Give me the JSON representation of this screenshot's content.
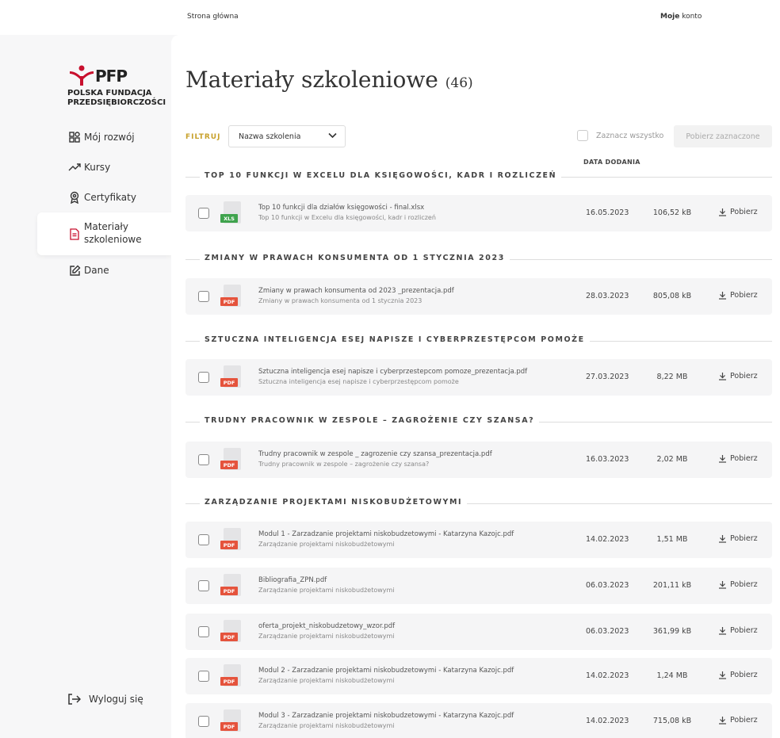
{
  "topbar": {
    "home_link": "Strona główna",
    "account_bold": "Moje",
    "account_rest": " konto"
  },
  "logo": {
    "brand": "PFP",
    "line1": "POLSKA FUNDACJA",
    "line2": "PRZEDSIĘBIORCZOŚCI",
    "brand_color": "#c8102e"
  },
  "sidebar": {
    "items": [
      {
        "label": "Mój rozwój",
        "icon": "grid-icon"
      },
      {
        "label": "Kursy",
        "icon": "trend-icon"
      },
      {
        "label": "Certyfikaty",
        "icon": "award-icon"
      },
      {
        "label": "Materiały szkoleniowe",
        "icon": "document-icon",
        "active": true
      },
      {
        "label": "Dane",
        "icon": "edit-icon"
      }
    ],
    "logout": "Wyloguj się"
  },
  "main": {
    "title": "Materiały szkoleniowe",
    "count": "(46)",
    "filter_label": "FILTRUJ",
    "filter_value": "Nazwa szkolenia",
    "select_all": "Zaznacz wszystko",
    "download_selected": "Pobierz zaznaczone",
    "date_header": "DATA DODANIA",
    "download_label": "Pobierz"
  },
  "sections": [
    {
      "title": "TOP 10 FUNKCJI W EXCELU DLA KSIĘGOWOŚCI, KADR I ROZLICZEŃ",
      "files": [
        {
          "type": "XLS",
          "name": "Top 10 funkcji dla działów księgowości - final.xlsx",
          "desc": "Top 10 funkcji w Excelu dla księgowości, kadr i rozliczeń",
          "date": "16.05.2023",
          "size": "106,52 kB"
        }
      ]
    },
    {
      "title": "ZMIANY W PRAWACH KONSUMENTA OD 1 STYCZNIA 2023",
      "files": [
        {
          "type": "PDF",
          "name": "Zmiany w prawach konsumenta od 2023 _prezentacja.pdf",
          "desc": "Zmiany w prawach konsumenta od 1 stycznia 2023",
          "date": "28.03.2023",
          "size": "805,08 kB"
        }
      ]
    },
    {
      "title": "SZTUCZNA INTELIGENCJA ESEJ NAPISZE I CYBERPRZESTĘPCOM POMOŻE",
      "files": [
        {
          "type": "PDF",
          "name": "Sztuczna inteligencja esej napisze i cyberprzestepcom pomoze_prezentacja.pdf",
          "desc": "Sztuczna inteligencja esej napisze i cyberprzestępcom pomoże",
          "date": "27.03.2023",
          "size": "8,22 MB"
        }
      ]
    },
    {
      "title": "TRUDNY PRACOWNIK W ZESPOLE – ZAGROŻENIE CZY SZANSA?",
      "files": [
        {
          "type": "PDF",
          "name": "Trudny pracownik w zespole _ zagrozenie czy szansa_prezentacja.pdf",
          "desc": "Trudny pracownik w zespole – zagrożenie czy szansa?",
          "date": "16.03.2023",
          "size": "2,02 MB"
        }
      ]
    },
    {
      "title": "ZARZĄDZANIE PROJEKTAMI NISKOBUDŻETOWYMI",
      "files": [
        {
          "type": "PDF",
          "name": "Modul 1 - Zarzadzanie projektami niskobudzetowymi - Katarzyna Kazojc.pdf",
          "desc": "Zarządzanie projektami niskobudżetowymi",
          "date": "14.02.2023",
          "size": "1,51 MB"
        },
        {
          "type": "PDF",
          "name": "Bibliografia_ZPN.pdf",
          "desc": "Zarządzanie projektami niskobudżetowymi",
          "date": "06.03.2023",
          "size": "201,11 kB"
        },
        {
          "type": "PDF",
          "name": "oferta_projekt_niskobudzetowy_wzor.pdf",
          "desc": "Zarządzanie projektami niskobudżetowymi",
          "date": "06.03.2023",
          "size": "361,99 kB"
        },
        {
          "type": "PDF",
          "name": "Modul 2 - Zarzadzanie projektami niskobudzetowymi - Katarzyna Kazojc.pdf",
          "desc": "Zarządzanie projektami niskobudżetowymi",
          "date": "14.02.2023",
          "size": "1,24 MB"
        },
        {
          "type": "PDF",
          "name": "Modul 3 - Zarzadzanie projektami niskobudzetowymi - Katarzyna Kazojc.pdf",
          "desc": "Zarządzanie projektami niskobudżetowymi",
          "date": "14.02.2023",
          "size": "715,08 kB"
        }
      ]
    }
  ]
}
